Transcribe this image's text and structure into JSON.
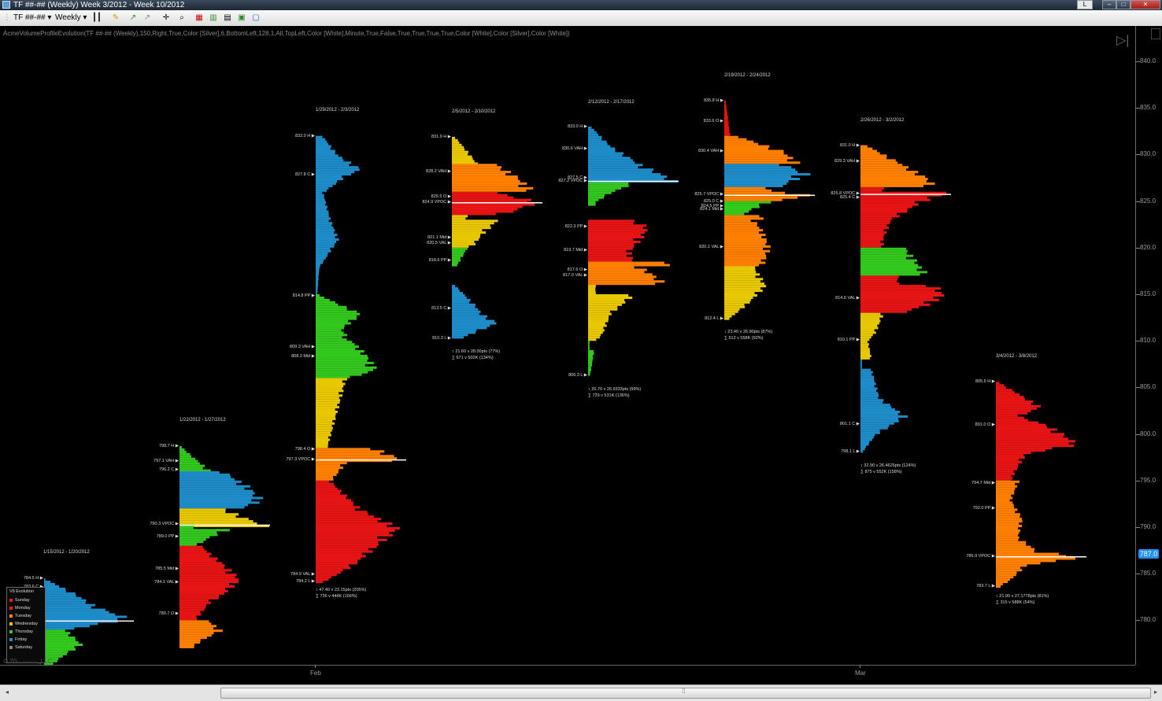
{
  "window": {
    "title": "TF ##-## (Weekly)  Week 3/2012 - Week 10/2012",
    "minimize": "–",
    "maximize": "□",
    "close": "✕",
    "badge": "L"
  },
  "toolbar": {
    "instrument": "TF ##-##",
    "period": "Weekly"
  },
  "indicator_params": "AcmeVolumeProfileEvolution(TF ##-## (Weekly),150,Right,True,Color [Silver],6,BottomLeft,128,1,All,TopLeft,Color [White],Minute,True,False,True,True,True,True,Color [White],Color [Silver],Color [White])",
  "axis": {
    "y_ticks": [
      "840.0",
      "835.0",
      "830.0",
      "825.0",
      "820.0",
      "815.0",
      "810.0",
      "805.0",
      "800.0",
      "795.0",
      "790.0",
      "785.0",
      "780.0"
    ],
    "x_ticks": [
      "Feb",
      "Mar"
    ],
    "last_price": "787.0"
  },
  "copyright": "© 20·· ·······, LLC",
  "legend": {
    "title": "V9 Evolution",
    "items": [
      {
        "label": "Sunday",
        "color": "#e02020"
      },
      {
        "label": "Monday",
        "color": "#ff1a1a"
      },
      {
        "label": "Tuesday",
        "color": "#ff8c00"
      },
      {
        "label": "Wednesday",
        "color": "#e6c800"
      },
      {
        "label": "Thursday",
        "color": "#32cd32"
      },
      {
        "label": "Friday",
        "color": "#1e90c8"
      },
      {
        "label": "Saturday",
        "color": "#888888"
      }
    ]
  },
  "profiles": [
    {
      "date": "1/15/2012 - 1/20/2012",
      "labels": [
        "784.5 H",
        "783.6 C",
        "783.0 VAH",
        "780.0 VPOC",
        "775.5 PP"
      ],
      "stat1": "",
      "stat2": ""
    },
    {
      "date": "1/22/2012 - 1/27/2012",
      "labels": [
        "798.7 H",
        "797.1 VAH",
        "796.2 C",
        "790.3 VPOC",
        "789.0 PP",
        "785.5 Mid",
        "784.1 VAL",
        "780.7 O"
      ],
      "stat1": "",
      "stat2": ""
    },
    {
      "date": "1/29/2012 - 2/3/2012",
      "labels": [
        "832.0 H",
        "827.8 C",
        "814.8 PP",
        "809.3 VAH",
        "808.3 Mid",
        "798.4 O",
        "797.3 VPOC",
        "784.9 VAL",
        "784.2 L"
      ],
      "stat1": "↕ 47.40 v  23.15pts (205%)",
      "stat2": "∑ 736 v 444K (166%)"
    },
    {
      "date": "2/5/2012 - 2/10/2012",
      "labels": [
        "831.9 H",
        "828.2 VAH",
        "825.5 O",
        "824.9 VPOC",
        "821.1 Mid",
        "820.5 VAL",
        "818.6 PP",
        "813.5 C",
        "810.3 L"
      ],
      "stat1": "↕ 21.60 v  28.00pts (77%)",
      "stat2": "∑ 671 v 502K (134%)"
    },
    {
      "date": "2/12/2012 - 2/17/2012",
      "labels": [
        "833.0 H",
        "830.6 VAH",
        "827.5 C",
        "827.2 VPOC",
        "822.3 PP",
        "819.7 Mid",
        "817.6 O",
        "817.0 VAL",
        "806.3 L"
      ],
      "stat1": "↕ 26.70 v  26.9333pts (99%)",
      "stat2": "∑ 729 v 531K (136%)"
    },
    {
      "date": "2/19/2012 - 2/24/2012",
      "labels": [
        "835.8 H",
        "833.6 O",
        "830.4 VAH",
        "825.7 VPOC",
        "825.0 C",
        "824.5 PP",
        "824.1 Mid",
        "820.1 VAL",
        "812.4 L"
      ],
      "stat1": "↕ 23.40 v  26.90pts (87%)",
      "stat2": "∑ 512 v 558K (92%)"
    },
    {
      "date": "2/26/2012 - 3/2/2012",
      "labels": [
        "831.0 H",
        "829.3 VAH",
        "825.8 VPOC",
        "825.4 C",
        "814.6 VAL",
        "810.1 PP",
        "801.1 C",
        "798.1 L"
      ],
      "stat1": "↕ 32.90 v  26.4625pts (124%)",
      "stat2": "∑ 875 v 552K (158%)"
    },
    {
      "date": "3/4/2012 - 3/8/2012",
      "labels": [
        "805.6 H",
        "801.0 O",
        "794.7 Mid",
        "792.0 PP",
        "786.9 VPOC",
        "783.7 L"
      ],
      "stat1": "↕ 21.90 v  27.1778pts (81%)",
      "stat2": "∑ 315 v 588K (54%)"
    }
  ]
}
